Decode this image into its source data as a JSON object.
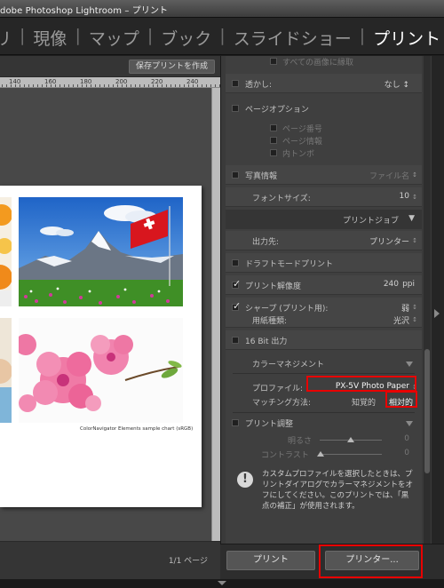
{
  "window": {
    "title": "dobe Photoshop Lightroom – プリント"
  },
  "modules": {
    "items": [
      "リ",
      "現像",
      "マップ",
      "ブック",
      "スライドショー",
      "プリント"
    ],
    "separator": "|",
    "more": "»",
    "active": "プリント"
  },
  "preview": {
    "save_print_button": "保存プリントを作成",
    "ruler_labels": [
      "140",
      "160",
      "180",
      "200",
      "220",
      "240"
    ],
    "chart_caption": "ColorNavigator Elements sample chart (sRGB)",
    "page_count": "1/1 ページ"
  },
  "panel": {
    "top_partial": "すべての画像に縁取",
    "watermark_label": "透かし:",
    "watermark_value": "なし ↕",
    "page_options_label": "ページオプション",
    "page_number": "ページ番号",
    "page_info": "ページ情報",
    "crop_marks": "内トンボ",
    "photo_info_label": "写真情報",
    "photo_info_value": "ファイル名",
    "font_size_label": "フォントサイズ:",
    "font_size_value": "10",
    "print_job_header": "プリントジョブ",
    "output_label": "出力先:",
    "output_value": "プリンター",
    "draft_mode": "ドラフトモードプリント",
    "print_resolution_label": "プリント解像度",
    "print_resolution_value": "240",
    "print_resolution_unit": "ppi",
    "sharpen_label": "シャープ (プリント用):",
    "sharpen_value": "弱",
    "media_type_label": "用紙種類:",
    "media_type_value": "光沢",
    "bit16_label": "16 Bit 出力",
    "color_management_header": "カラーマネジメント",
    "profile_label": "プロファイル:",
    "profile_value": "PX-5V Photo Paper",
    "intent_label": "マッチング方法:",
    "intent_perceptual": "知覚的",
    "intent_relative": "相対的",
    "print_adjust_label": "プリント調整",
    "brightness_label": "明るさ",
    "brightness_value": "0",
    "contrast_label": "コントラスト",
    "contrast_value": "0",
    "info_text": "カスタムプロファイルを選択したときは、プリントダイアログでカラーマネジメントをオフにしてください。このプリントでは、「黒点の補正」が使用されます。",
    "stepper": "↕",
    "collapse": "▼"
  },
  "bottom": {
    "print_button": "プリント",
    "printer_button": "プリンター..."
  },
  "colors": {
    "highlight": "#e80000",
    "panel": "#3f3f3f",
    "text": "#c2c2c2"
  }
}
